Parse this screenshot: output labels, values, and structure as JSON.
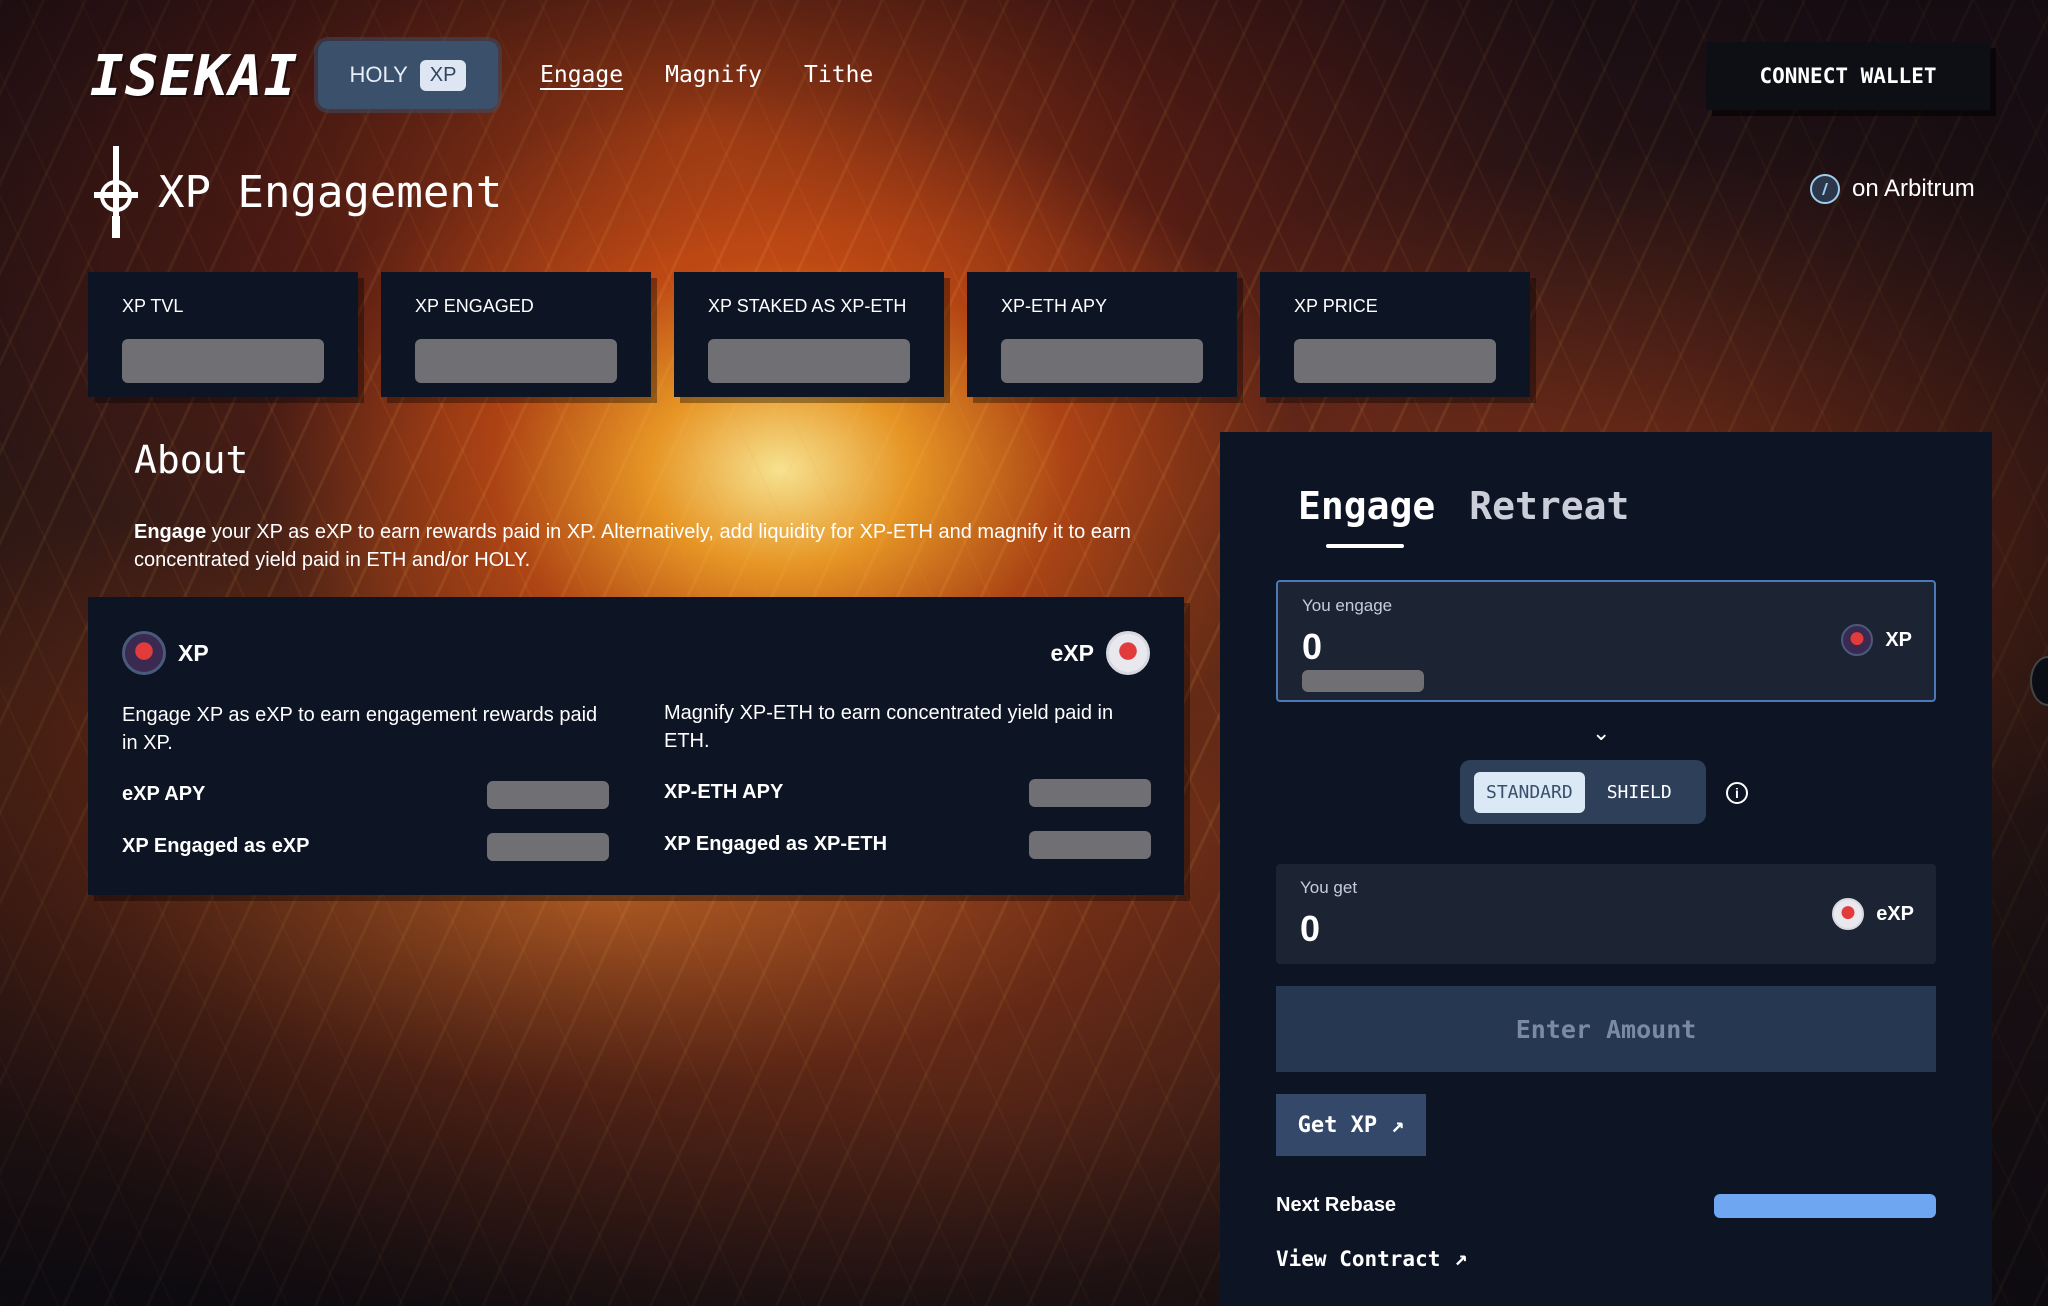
{
  "header": {
    "logo": "ISEKAI",
    "token_switch": {
      "holy": "HOLY",
      "xp": "XP"
    },
    "nav": [
      "Engage",
      "Magnify",
      "Tithe"
    ],
    "connect_wallet": "CONNECT WALLET"
  },
  "title": "XP Engagement",
  "network": "on Arbitrum",
  "stats": [
    {
      "label": "XP TVL"
    },
    {
      "label": "XP ENGAGED"
    },
    {
      "label": "XP STAKED AS XP-ETH"
    },
    {
      "label": "XP-ETH APY"
    },
    {
      "label": "XP PRICE"
    }
  ],
  "about": {
    "title": "About",
    "lead": "Engage",
    "text": " your XP as eXP to earn rewards paid in XP. Alternatively, add liquidity for XP-ETH and magnify it to earn concentrated yield paid in ETH and/or HOLY."
  },
  "info_card": {
    "left": {
      "token": "XP",
      "desc": "Engage XP as eXP to earn engagement rewards paid in XP.",
      "rows": [
        "eXP APY",
        "XP Engaged as eXP"
      ]
    },
    "right": {
      "token": "eXP",
      "desc": "Magnify XP-ETH to earn concentrated yield paid in ETH.",
      "rows": [
        "XP-ETH APY",
        "XP Engaged as XP-ETH"
      ]
    }
  },
  "panel": {
    "tabs": [
      "Engage",
      "Retreat"
    ],
    "you_engage": {
      "label": "You engage",
      "value": "0",
      "token": "XP"
    },
    "mode": {
      "standard": "STANDARD",
      "shield": "SHIELD"
    },
    "you_get": {
      "label": "You get",
      "value": "0",
      "token": "eXP"
    },
    "enter_amount": "Enter Amount",
    "get_xp": "Get XP",
    "next_rebase": "Next Rebase",
    "view_contract": "View Contract"
  },
  "icons": {
    "sword": "sword-icon",
    "arbitrum": "arbitrum-icon",
    "xp_coin": "xp-coin-icon",
    "exp_coin": "exp-coin-icon",
    "chevron": "chevron-down-icon",
    "info": "info-icon",
    "external": "external-link-icon"
  },
  "colors": {
    "panel_bg": "#0d1424",
    "accent_blue": "#4b78b7",
    "rebase_bar": "#6ea6f2"
  }
}
